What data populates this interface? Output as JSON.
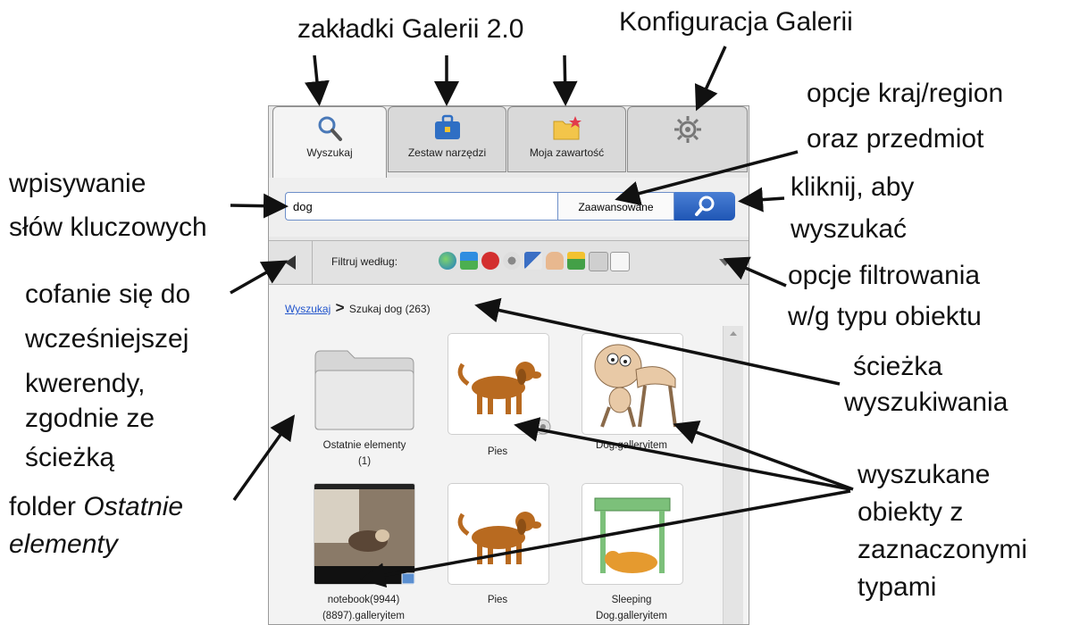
{
  "annotations": {
    "tabs_title": "zakładki Galerii 2.0",
    "config": "Konfiguracja Galerii",
    "country_l1": "opcje kraj/region",
    "country_l2": "oraz przedmiot",
    "keywords_l1": "wpisywanie",
    "keywords_l2": "słów kluczowych",
    "click_l1": "kliknij, aby",
    "click_l2": "wyszukać",
    "back_l1": "cofanie się do",
    "back_l2": "wcześniejszej",
    "back_l3": "kwerendy,",
    "back_l4": "zgodnie ze",
    "back_l5": "ścieżką",
    "filter_l1": "opcje filtrowania",
    "filter_l2": "w/g typu obiektu",
    "path_l1": "ścieżka",
    "path_l2": "wyszukiwania",
    "recent_l1_a": "folder ",
    "recent_l1_b": "Ostatnie",
    "recent_l2": "elementy",
    "found_l1": "wyszukane",
    "found_l2": "obiekty z",
    "found_l3": "zaznaczonymi",
    "found_l4": "typami"
  },
  "tabs": [
    {
      "label": "Wyszukaj",
      "icon": "magnifier-icon"
    },
    {
      "label": "Zestaw narzędzi",
      "icon": "toolbox-icon"
    },
    {
      "label": "Moja zawartość",
      "icon": "folder-star-icon"
    },
    {
      "label": "",
      "icon": "gear-icon"
    }
  ],
  "search": {
    "value": "dog",
    "advanced_label": "Zaawansowane"
  },
  "filter": {
    "label": "Filtruj według:",
    "icons": [
      "globe-icon",
      "picture-icon",
      "flash-icon",
      "sound-icon",
      "document-image-icon",
      "hand-icon",
      "landscape-icon",
      "copy-icon",
      "page-icon"
    ]
  },
  "breadcrumb": {
    "link": "Wyszukaj",
    "separator": ">",
    "current": "Szukaj dog (263)"
  },
  "items": [
    {
      "caption_l1": "Ostatnie elementy",
      "caption_l2": "(1)",
      "type": "folder"
    },
    {
      "caption_l1": "Pies",
      "caption_l2": "",
      "type": "image-with-sound"
    },
    {
      "caption_l1": "Dog.galleryitem",
      "caption_l2": "",
      "type": "gallery-item"
    },
    {
      "caption_l1": "notebook(9944)",
      "caption_l2": "(8897).galleryitem",
      "type": "video"
    },
    {
      "caption_l1": "Pies",
      "caption_l2": "",
      "type": "image"
    },
    {
      "caption_l1": "Sleeping",
      "caption_l2": "Dog.galleryitem",
      "type": "gallery-item"
    }
  ],
  "colors": {
    "accent": "#1f56b5",
    "link": "#2255cc",
    "panel": "#e9e9e9"
  }
}
